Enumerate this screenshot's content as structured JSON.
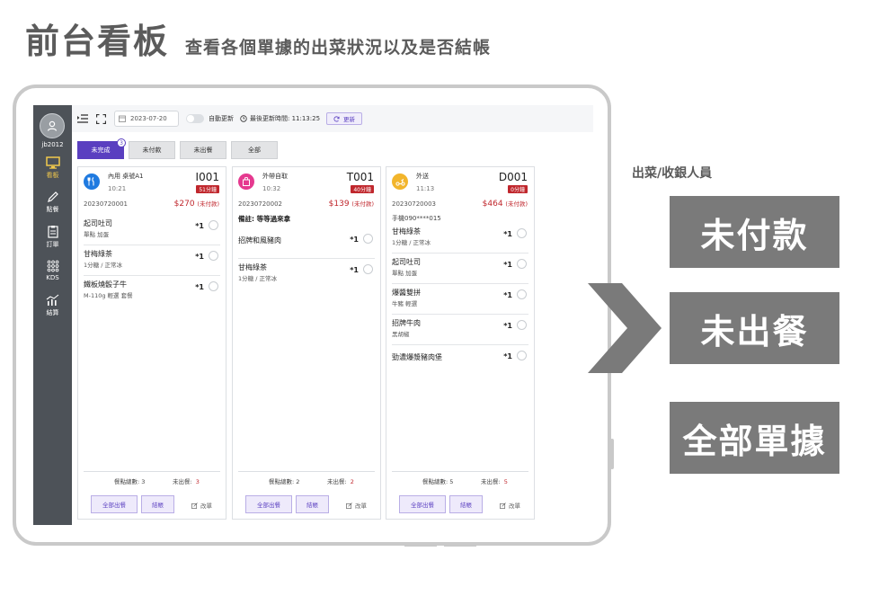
{
  "header": {
    "title": "前台看板",
    "subtitle": "查看各個單據的出菜狀況以及是否結帳"
  },
  "sidebar": {
    "user": "jb2012",
    "items": [
      {
        "label": "看板",
        "icon": "monitor-icon",
        "active": true
      },
      {
        "label": "點餐",
        "icon": "pencil-icon",
        "active": false
      },
      {
        "label": "訂單",
        "icon": "clipboard-icon",
        "active": false
      },
      {
        "label": "KDS",
        "icon": "grid-dots-icon",
        "active": false
      },
      {
        "label": "結算",
        "icon": "chart-icon",
        "active": false
      }
    ]
  },
  "toolbar": {
    "date": "2023-07-20",
    "auto_update": "自動更新",
    "last_update": "最後更新時間: 11:13:25",
    "refresh": "更新"
  },
  "tabs": [
    {
      "label": "未完成",
      "active": true,
      "badge": "3"
    },
    {
      "label": "未付款",
      "active": false
    },
    {
      "label": "未出餐",
      "active": false
    },
    {
      "label": "全部",
      "active": false
    }
  ],
  "orders": [
    {
      "type": "內用 桌號A1",
      "time": "10:21",
      "code": "I001",
      "wait": "51分鐘",
      "number": "20230720001",
      "price": "$270",
      "pay_status": "(未付款)",
      "note": "",
      "icon_color": "#1f7ae0",
      "items": [
        {
          "name": "起司吐司",
          "opt": "單點 加蛋",
          "qty": "*1"
        },
        {
          "name": "甘梅綠茶",
          "opt": "1分糖 / 正常冰",
          "qty": "*1"
        },
        {
          "name": "鐵板燒骰子牛",
          "opt": "M-110g 輕選 套餐",
          "qty": "*1"
        }
      ],
      "total_label": "餐點總數: 3",
      "pending_label": "未出餐:",
      "pending_count": "3",
      "serve_label": "全部出餐",
      "pay_label": "結帳",
      "edit_label": "改單"
    },
    {
      "type": "外帶自取",
      "time": "10:32",
      "code": "T001",
      "wait": "40分鐘",
      "number": "20230720002",
      "price": "$139",
      "pay_status": "(未付款)",
      "note": "備註: 等等過來拿",
      "icon_color": "#e5398f",
      "items": [
        {
          "name": "招牌和風豬肉",
          "opt": "",
          "qty": "*1"
        },
        {
          "name": "甘梅綠茶",
          "opt": "1分糖 / 正常冰",
          "qty": "*1"
        }
      ],
      "total_label": "餐點總數: 2",
      "pending_label": "未出餐:",
      "pending_count": "2",
      "serve_label": "全部出餐",
      "pay_label": "結帳",
      "edit_label": "改單"
    },
    {
      "type": "外送",
      "time": "11:13",
      "code": "D001",
      "wait": "0分鐘",
      "number": "20230720003",
      "price": "$464",
      "pay_status": "(未付款)",
      "note": "手機090****015",
      "icon_color": "#f2b52c",
      "items": [
        {
          "name": "甘梅綠茶",
          "opt": "1分糖 / 正常冰",
          "qty": "*1"
        },
        {
          "name": "起司吐司",
          "opt": "單點 加蛋",
          "qty": "*1"
        },
        {
          "name": "爆醬雙拼",
          "opt": "牛豬 輕選",
          "qty": "*1"
        },
        {
          "name": "招牌牛肉",
          "opt": "黑胡椒",
          "qty": "*1"
        },
        {
          "name": "勁濃爆漿豬肉堡",
          "opt": "",
          "qty": "*1"
        }
      ],
      "total_label": "餐點總數: 5",
      "pending_label": "未出餐:",
      "pending_count": "5",
      "serve_label": "全部出餐",
      "pay_label": "結帳",
      "edit_label": "改單"
    }
  ],
  "right_panel": {
    "label": "出菜/收銀人員",
    "buttons": [
      "未付款",
      "未出餐",
      "全部單據"
    ]
  }
}
